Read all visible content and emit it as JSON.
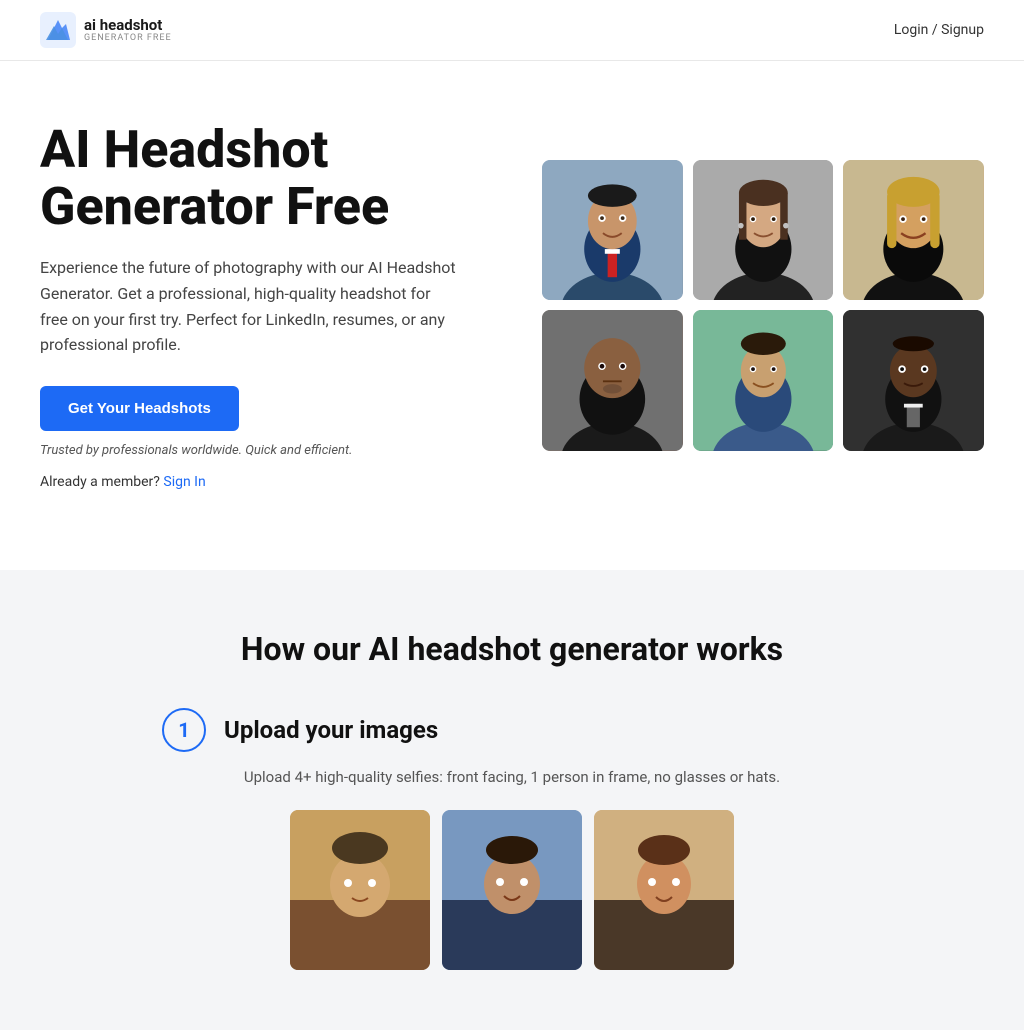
{
  "nav": {
    "logo_title": "ai headshot",
    "logo_subtitle": "GENERATOR FREE",
    "auth_label": "Login / Signup"
  },
  "hero": {
    "title": "AI Headshot Generator Free",
    "description": "Experience the future of photography with our AI Headshot Generator. Get a professional, high-quality headshot for free on your first try. Perfect for LinkedIn, resumes, or any professional profile.",
    "cta_button": "Get Your Headshots",
    "trust_text": "Trusted by professionals worldwide. Quick and efficient.",
    "already_member_prefix": "Already a member?",
    "sign_in_label": "Sign In"
  },
  "headshots": {
    "photos": [
      {
        "id": "p1",
        "alt": "Professional man in suit with red tie"
      },
      {
        "id": "p2",
        "alt": "Professional woman in black blazer"
      },
      {
        "id": "p3",
        "alt": "Blonde woman smiling"
      },
      {
        "id": "p4",
        "alt": "Bald man serious expression"
      },
      {
        "id": "p5",
        "alt": "Young man in suit smiling"
      },
      {
        "id": "p6",
        "alt": "Black man in dark suit with tie"
      }
    ]
  },
  "how_section": {
    "title": "How our AI headshot generator works",
    "step1": {
      "number": "1",
      "title": "Upload your images",
      "description": "Upload 4+ high-quality selfies: front facing, 1 person in frame, no glasses or hats."
    }
  },
  "sample_photos": [
    {
      "id": "sp1",
      "alt": "Sample selfie 1"
    },
    {
      "id": "sp2",
      "alt": "Sample selfie 2"
    },
    {
      "id": "sp3",
      "alt": "Sample selfie 3"
    }
  ]
}
